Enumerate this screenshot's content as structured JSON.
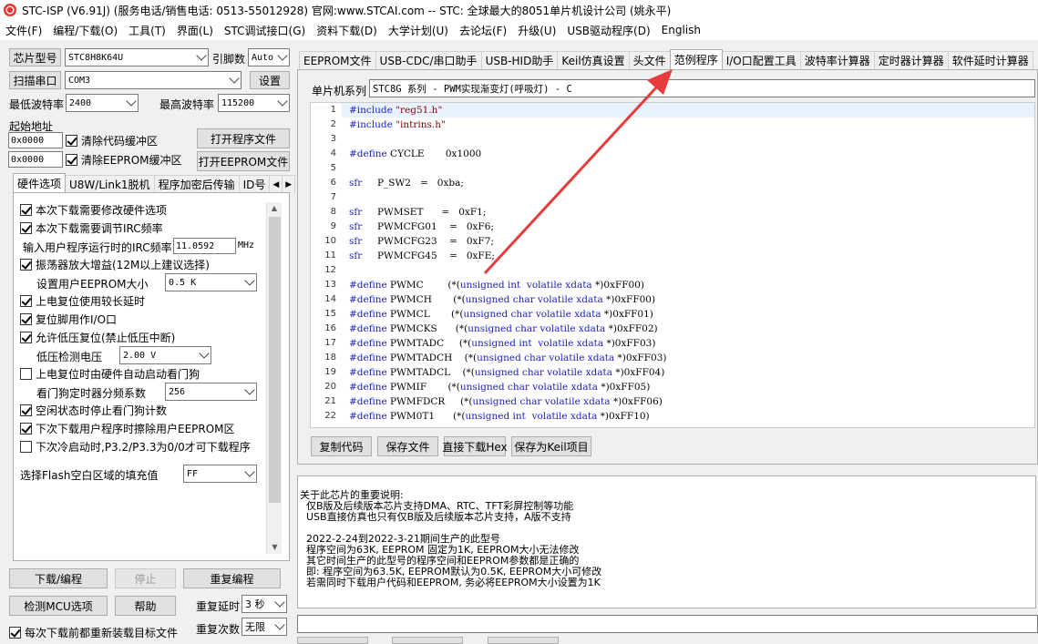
{
  "window": {
    "title": "STC-ISP (V6.91J) (服务电话/销售电话: 0513-55012928) 官网:www.STCAI.com  -- STC: 全球最大的8051单片机设计公司 (姚永平)"
  },
  "menu": [
    "文件(F)",
    "编程/下载(O)",
    "工具(T)",
    "界面(L)",
    "STC调试接口(G)",
    "资料下载(D)",
    "大学计划(U)",
    "去论坛(F)",
    "升级(U)",
    "USB驱动程序(D)",
    "English"
  ],
  "left": {
    "chip_label": "芯片型号",
    "chip_value": "STC8H8K64U",
    "pin_label": "引脚数",
    "pin_value": "Auto",
    "scan_label": "扫描串口",
    "com_value": "COM3",
    "settings_btn": "设置",
    "min_baud_label": "最低波特率",
    "min_baud": "2400",
    "max_baud_label": "最高波特率",
    "max_baud": "115200",
    "start_addr_label": "起始地址",
    "addr1": "0x0000",
    "clear_code": "清除代码缓冲区",
    "open_prog": "打开程序文件",
    "addr2": "0x0000",
    "clear_eeprom": "清除EEPROM缓冲区",
    "open_eeprom": "打开EEPROM文件",
    "tabs": [
      "硬件选项",
      "U8W/Link1脱机",
      "程序加密后传输",
      "ID号"
    ],
    "options": {
      "o1": "本次下载需要修改硬件选项",
      "o2": "本次下载需要调节IRC频率",
      "freq_label": "输入用户程序运行时的IRC频率",
      "freq_value": "11.0592",
      "freq_unit": "MHz",
      "o3": "振荡器放大增益(12M以上建议选择)",
      "eeprom_label": "设置用户EEPROM大小",
      "eeprom_value": "0.5 K",
      "o4": "上电复位使用较长延时",
      "o5": "复位脚用作I/O口",
      "o6": "允许低压复位(禁止低压中断)",
      "lv_label": "低压检测电压",
      "lv_value": "2.00 V",
      "o7": "上电复位时由硬件自动启动看门狗",
      "wdt_label": "看门狗定时器分频系数",
      "wdt_value": "256",
      "o8": "空闲状态时停止看门狗计数",
      "o9": "下次下载用户程序时擦除用户EEPROM区",
      "o10": "下次冷启动时,P3.2/P3.3为0/0才可下载程序",
      "flash_label": "选择Flash空白区域的填充值",
      "flash_value": "FF"
    },
    "download_btn": "下载/编程",
    "stop_btn": "停止",
    "reprog_btn": "重复编程",
    "detect_btn": "检测MCU选项",
    "help_btn": "帮助",
    "delay_label": "重复延时",
    "delay_value": "3 秒",
    "count_label": "重复次数",
    "count_value": "无限",
    "reload_chk": "每次下载前都重新装载目标文件"
  },
  "right": {
    "tabs": [
      "EEPROM文件",
      "USB-CDC/串口助手",
      "USB-HID助手",
      "Keil仿真设置",
      "头文件",
      "范例程序",
      "I/O口配置工具",
      "波特率计算器",
      "定时器计算器",
      "软件延时计算器"
    ],
    "series_label": "单片机系列",
    "series_value": "STC8G 系列 - PWM实现渐变灯(呼吸灯) - C",
    "code": [
      {
        "n": "1",
        "t": "#include \"reg51.h\""
      },
      {
        "n": "2",
        "t": "#include \"intrins.h\""
      },
      {
        "n": "3",
        "t": ""
      },
      {
        "n": "4",
        "t": "#define CYCLE       0x1000"
      },
      {
        "n": "5",
        "t": ""
      },
      {
        "n": "6",
        "t": "sfr     P_SW2   =   0xba;"
      },
      {
        "n": "7",
        "t": ""
      },
      {
        "n": "8",
        "t": "sfr     PWMSET      =   0xF1;"
      },
      {
        "n": "9",
        "t": "sfr     PWMCFG01    =   0xF6;"
      },
      {
        "n": "10",
        "t": "sfr     PWMCFG23    =   0xF7;"
      },
      {
        "n": "11",
        "t": "sfr     PWMCFG45    =   0xFE;"
      },
      {
        "n": "12",
        "t": ""
      },
      {
        "n": "13",
        "t": "#define PWMC        (*(unsigned int  volatile xdata *)0xFF00)"
      },
      {
        "n": "14",
        "t": "#define PWMCH       (*(unsigned char volatile xdata *)0xFF00)"
      },
      {
        "n": "15",
        "t": "#define PWMCL       (*(unsigned char volatile xdata *)0xFF01)"
      },
      {
        "n": "16",
        "t": "#define PWMCKS      (*(unsigned char volatile xdata *)0xFF02)"
      },
      {
        "n": "17",
        "t": "#define PWMTADC     (*(unsigned int  volatile xdata *)0xFF03)"
      },
      {
        "n": "18",
        "t": "#define PWMTADCH    (*(unsigned char volatile xdata *)0xFF03)"
      },
      {
        "n": "19",
        "t": "#define PWMTADCL    (*(unsigned char volatile xdata *)0xFF04)"
      },
      {
        "n": "20",
        "t": "#define PWMIF       (*(unsigned char volatile xdata *)0xFF05)"
      },
      {
        "n": "21",
        "t": "#define PWMFDCR     (*(unsigned char volatile xdata *)0xFF06)"
      },
      {
        "n": "22",
        "t": "#define PWM0T1      (*(unsigned int  volatile xdata *)0xFF10)"
      }
    ],
    "copy_btn": "复制代码",
    "save_btn": "保存文件",
    "hex_btn": "直接下载Hex",
    "keil_btn": "保存为Keil项目",
    "info": "关于此芯片的重要说明:\n  仅B版及后续版本芯片支持DMA、RTC、TFT彩屏控制等功能\n  USB直接仿真也只有仅B版及后续版本芯片支持，A版不支持\n\n  2022-2-24到2022-3-21期间生产的此型号\n  程序空间为63K, EEPROM 固定为1K, EEPROM大小无法修改\n  其它时间生产的此型号的程序空间和EEPROM参数都是正确的\n  即: 程序空间为63.5K, EEPROM默认为0.5K, EEPROM大小可修改\n  若需同时下载用户代码和EEPROM, 务必将EEPROM大小设置为1K"
  },
  "colors": {
    "arrow": "#e83c3c",
    "accent": "#0078d7"
  }
}
